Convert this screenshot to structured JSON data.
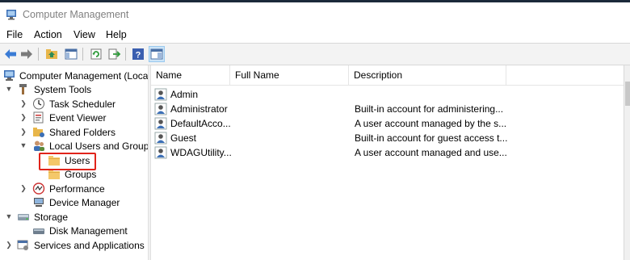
{
  "window": {
    "title": "Computer Management"
  },
  "menu": [
    "File",
    "Action",
    "View",
    "Help"
  ],
  "toolbar": [
    "back-icon",
    "forward-icon",
    "up-folder-icon",
    "show-hide-tree-icon",
    "refresh-icon",
    "export-list-icon",
    "help-icon",
    "properties-icon"
  ],
  "tree": [
    {
      "label": "Computer Management (Local",
      "icon": "computer-management-icon"
    },
    {
      "label": "System Tools",
      "icon": "system-tools-icon"
    },
    {
      "label": "Task Scheduler",
      "icon": "task-scheduler-icon"
    },
    {
      "label": "Event Viewer",
      "icon": "event-viewer-icon"
    },
    {
      "label": "Shared Folders",
      "icon": "shared-folders-icon"
    },
    {
      "label": "Local Users and Groups",
      "icon": "users-groups-icon"
    },
    {
      "label": "Users",
      "icon": "folder-icon",
      "selected": true
    },
    {
      "label": "Groups",
      "icon": "folder-icon"
    },
    {
      "label": "Performance",
      "icon": "performance-icon"
    },
    {
      "label": "Device Manager",
      "icon": "device-manager-icon"
    },
    {
      "label": "Storage",
      "icon": "storage-icon"
    },
    {
      "label": "Disk Management",
      "icon": "disk-management-icon"
    },
    {
      "label": "Services and Applications",
      "icon": "services-icon"
    }
  ],
  "columns": [
    "Name",
    "Full Name",
    "Description"
  ],
  "users": [
    {
      "name": "Admin",
      "full_name": "",
      "description": ""
    },
    {
      "name": "Administrator",
      "full_name": "",
      "description": "Built-in account for administering..."
    },
    {
      "name": "DefaultAcco...",
      "full_name": "",
      "description": "A user account managed by the s..."
    },
    {
      "name": "Guest",
      "full_name": "",
      "description": "Built-in account for guest access t..."
    },
    {
      "name": "WDAGUtility...",
      "full_name": "",
      "description": "A user account managed and use..."
    }
  ],
  "colors": {
    "highlight": "#e0241b",
    "title_text": "#808080",
    "folder": "#f4c86a"
  }
}
